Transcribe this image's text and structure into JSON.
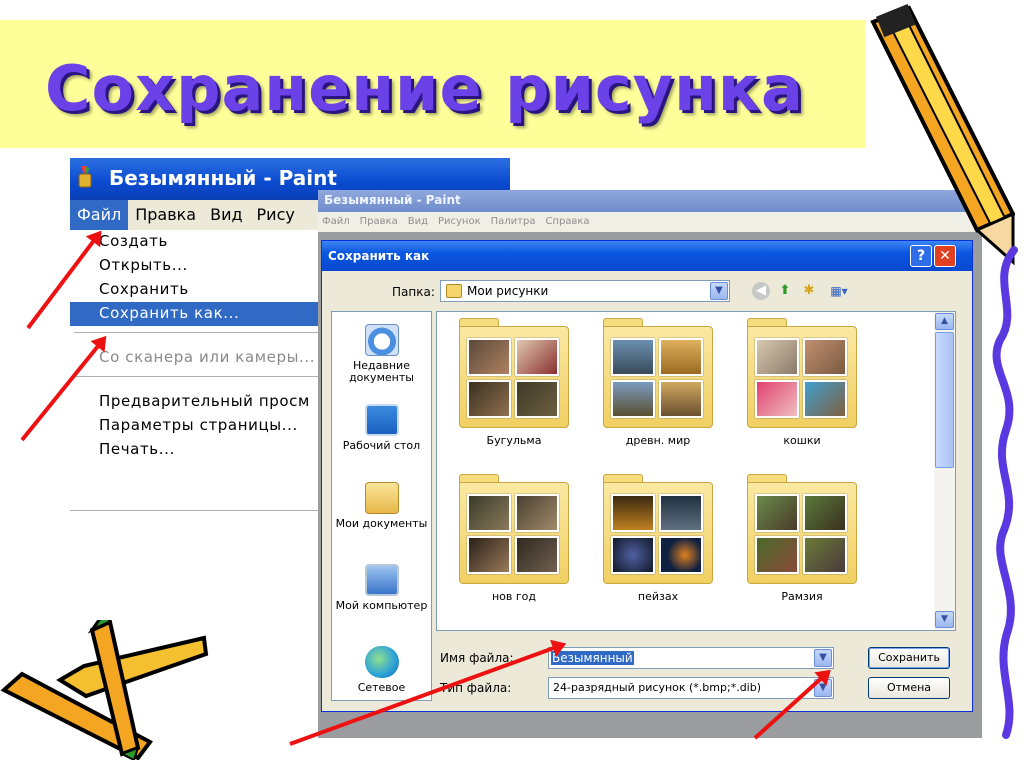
{
  "slide": {
    "title": "Сохранение рисунка"
  },
  "menu_window": {
    "title": "Безымянный - Paint",
    "menubar": [
      "Файл",
      "Правка",
      "Вид",
      "Рису"
    ],
    "items": [
      "Создать",
      "Открыть...",
      "Сохранить",
      "Сохранить как...",
      "Со сканера или камеры...",
      "Предварительный просм",
      "Параметры страницы...",
      "Печать..."
    ]
  },
  "paint_window": {
    "title": "Безымянный - Paint",
    "menubar": [
      "Файл",
      "Правка",
      "Вид",
      "Рисунок",
      "Палитра",
      "Справка"
    ]
  },
  "dialog": {
    "title": "Сохранить как",
    "help_label": "?",
    "close_label": "✕",
    "folder_label": "Папка:",
    "folder_value": "Мои рисунки",
    "places": [
      "Недавние документы",
      "Рабочий стол",
      "Мои документы",
      "Мой компьютер",
      "Сетевое"
    ],
    "folders": [
      "Бугульма",
      "древн. мир",
      "кошки",
      "нов год",
      "пейзах",
      "Рамзия"
    ],
    "filename_label": "Имя файла:",
    "filename_value": "Безымянный",
    "filetype_label": "Тип файла:",
    "filetype_value": "24-разрядный рисунок (*.bmp;*.dib)",
    "save_label": "Сохранить",
    "cancel_label": "Отмена"
  },
  "icons": [
    "paint-app-icon",
    "back-icon",
    "up-folder-icon",
    "new-folder-icon",
    "views-icon",
    "recent-documents-icon",
    "desktop-icon",
    "my-documents-icon",
    "my-computer-icon",
    "network-icon",
    "folder-icon"
  ],
  "colors": {
    "title_text": "#6a42e8",
    "title_band": "#ffff99",
    "selection": "#316ac5",
    "arrow": "#ee1111"
  }
}
